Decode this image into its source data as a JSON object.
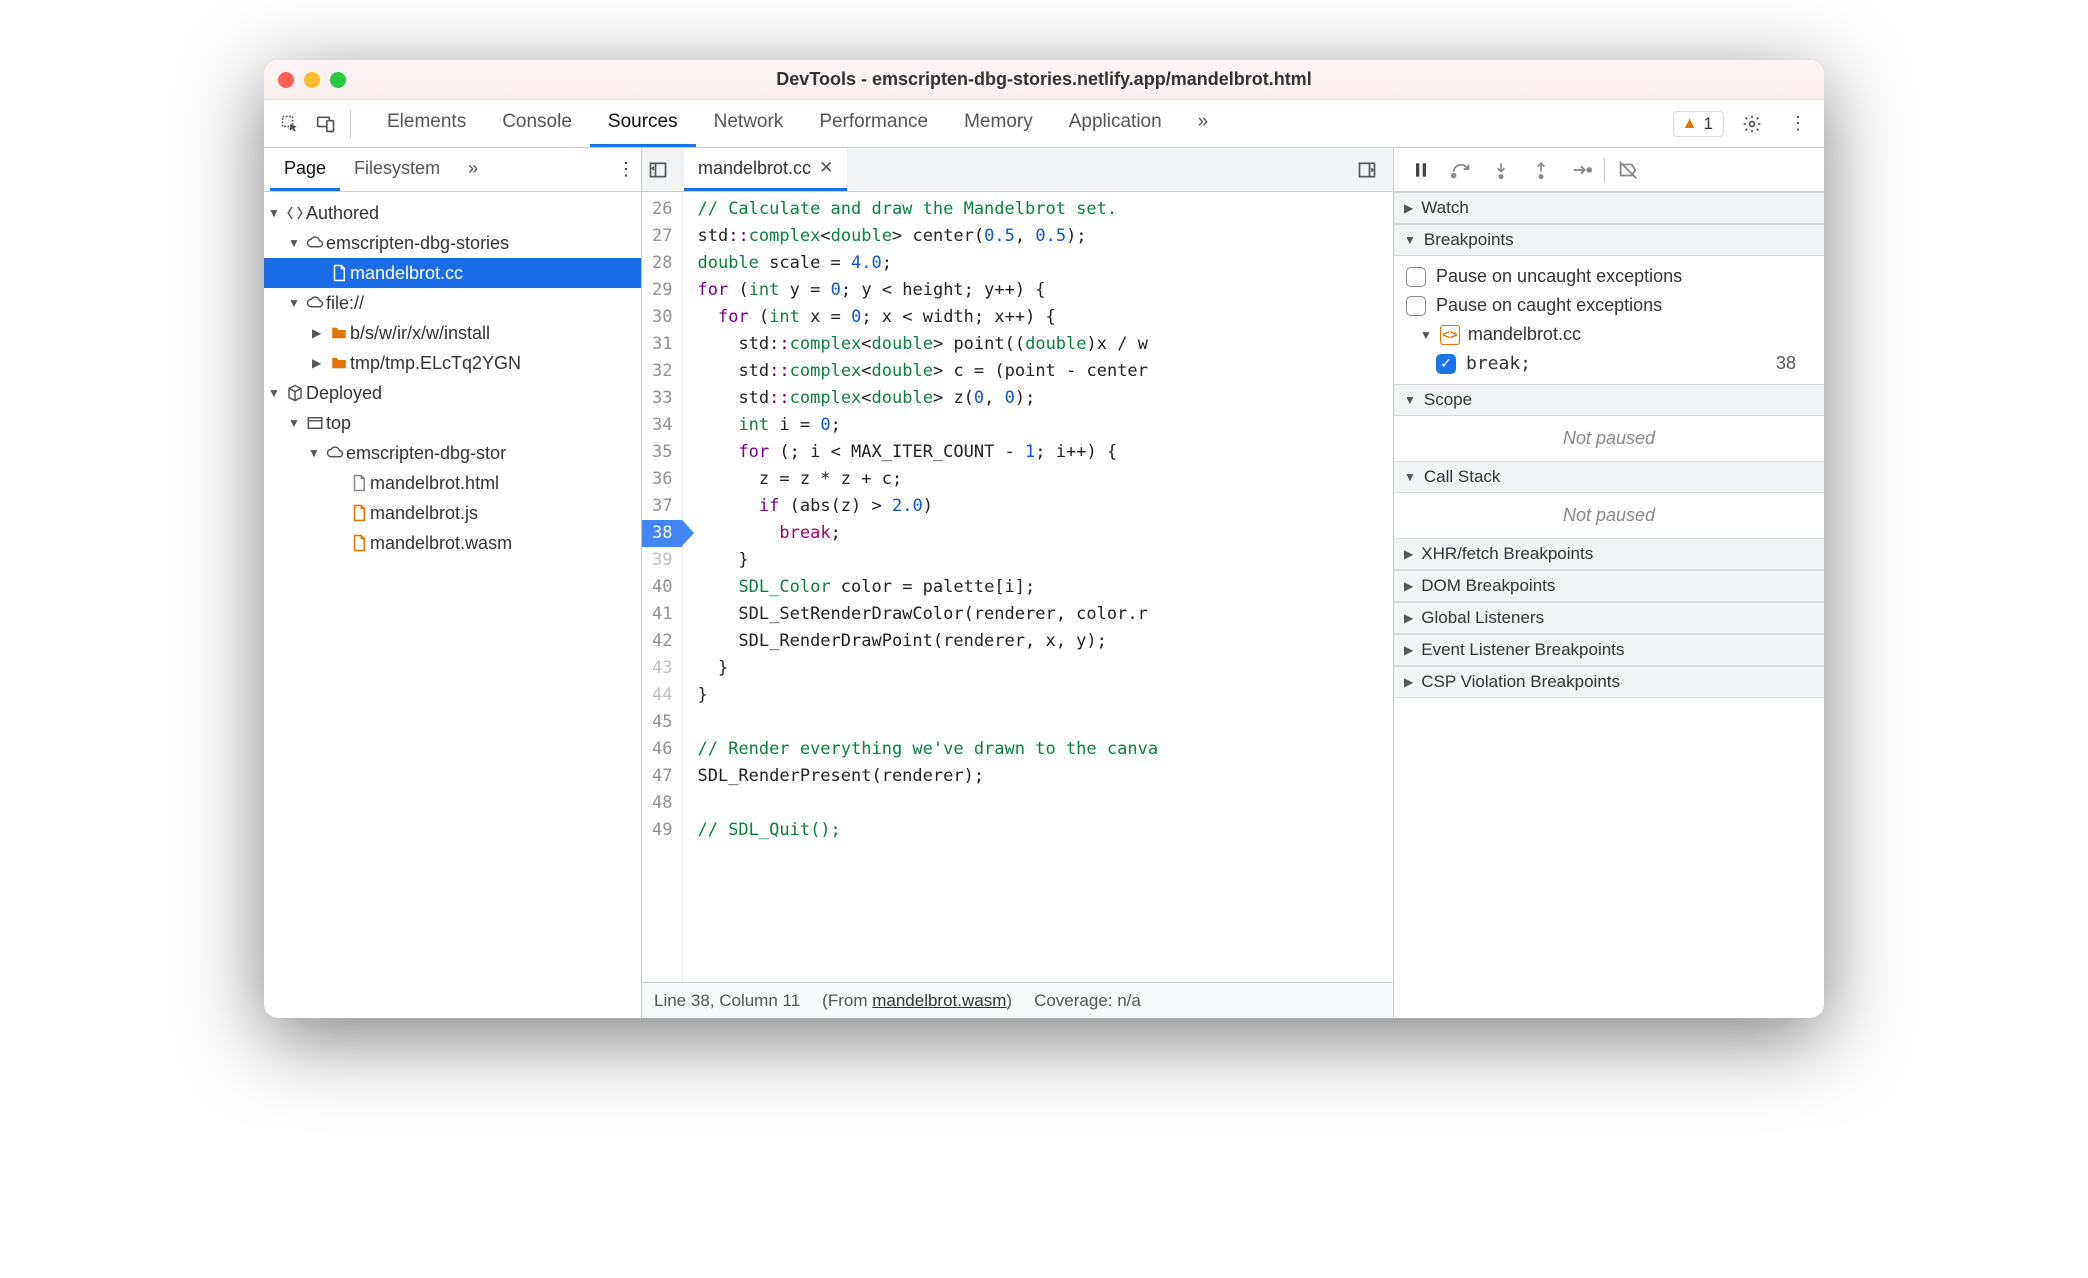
{
  "window": {
    "title": "DevTools - emscripten-dbg-stories.netlify.app/mandelbrot.html"
  },
  "toolbar": {
    "tabs": [
      "Elements",
      "Console",
      "Sources",
      "Network",
      "Performance",
      "Memory",
      "Application"
    ],
    "active": 2,
    "warning_count": "1"
  },
  "left": {
    "tabs": [
      "Page",
      "Filesystem"
    ],
    "active": 0,
    "tree": {
      "authored": "Authored",
      "emscripten": "emscripten-dbg-stories",
      "mandelbrot_cc": "mandelbrot.cc",
      "file_proto": "file://",
      "install": "b/s/w/ir/x/w/install",
      "tmp": "tmp/tmp.ELcTq2YGN",
      "deployed": "Deployed",
      "top": "top",
      "emscripten2": "emscripten-dbg-stor",
      "html": "mandelbrot.html",
      "js": "mandelbrot.js",
      "wasm": "mandelbrot.wasm"
    }
  },
  "center": {
    "file_tab": "mandelbrot.cc",
    "status": {
      "cursor": "Line 38, Column 11",
      "from_prefix": "(From ",
      "from_link": "mandelbrot.wasm",
      "from_suffix": ")",
      "coverage": "Coverage: n/a"
    },
    "lines": [
      {
        "n": 26,
        "html": "<span class='c-comment'>// Calculate and draw the Mandelbrot set.</span>"
      },
      {
        "n": 27,
        "html": "<span class='c-std'>std</span><span class='c-op'>::</span><span class='c-type'>complex</span>&lt;<span class='c-type'>double</span>&gt; center(<span class='c-num'>0.5</span>, <span class='c-num'>0.5</span>);"
      },
      {
        "n": 28,
        "html": "<span class='c-type'>double</span> scale = <span class='c-num'>4.0</span>;"
      },
      {
        "n": 29,
        "html": "<span class='c-kw'>for</span> (<span class='c-type'>int</span> y = <span class='c-num'>0</span>; y &lt; height; y++) {"
      },
      {
        "n": 30,
        "html": "  <span class='c-kw'>for</span> (<span class='c-type'>int</span> x = <span class='c-num'>0</span>; x &lt; width; x++) {"
      },
      {
        "n": 31,
        "html": "    <span class='c-std'>std</span><span class='c-op'>::</span><span class='c-type'>complex</span>&lt;<span class='c-type'>double</span>&gt; point((<span class='c-type'>double</span>)x / w"
      },
      {
        "n": 32,
        "html": "    <span class='c-std'>std</span><span class='c-op'>::</span><span class='c-type'>complex</span>&lt;<span class='c-type'>double</span>&gt; c = (point - center"
      },
      {
        "n": 33,
        "html": "    <span class='c-std'>std</span><span class='c-op'>::</span><span class='c-type'>complex</span>&lt;<span class='c-type'>double</span>&gt; z(<span class='c-num'>0</span>, <span class='c-num'>0</span>);"
      },
      {
        "n": 34,
        "html": "    <span class='c-type'>int</span> i = <span class='c-num'>0</span>;"
      },
      {
        "n": 35,
        "html": "    <span class='c-kw'>for</span> (; i &lt; MAX_ITER_COUNT - <span class='c-num'>1</span>; i++) {"
      },
      {
        "n": 36,
        "html": "      z = z * z + c;"
      },
      {
        "n": 37,
        "html": "      <span class='c-kw'>if</span> (abs(z) &gt; <span class='c-num'>2.0</span>)"
      },
      {
        "n": 38,
        "html": "        <span class='c-brk'>break</span>;",
        "bp": true
      },
      {
        "n": 39,
        "html": "    }",
        "off": true
      },
      {
        "n": 40,
        "html": "    <span class='c-func'>SDL_Color</span> color = palette[i];"
      },
      {
        "n": 41,
        "html": "    SDL_SetRenderDrawColor(renderer, color.r"
      },
      {
        "n": 42,
        "html": "    SDL_RenderDrawPoint(renderer, x, y);"
      },
      {
        "n": 43,
        "html": "  }",
        "off": true
      },
      {
        "n": 44,
        "html": "}",
        "off": true
      },
      {
        "n": 45,
        "html": ""
      },
      {
        "n": 46,
        "html": "<span class='c-comment'>// Render everything we've drawn to the canva</span>"
      },
      {
        "n": 47,
        "html": "SDL_RenderPresent(renderer);"
      },
      {
        "n": 48,
        "html": ""
      },
      {
        "n": 49,
        "html": "<span class='c-comment'>// SDL_Quit();</span>"
      }
    ]
  },
  "right": {
    "watch": "Watch",
    "breakpoints": "Breakpoints",
    "pause_uncaught": "Pause on uncaught exceptions",
    "pause_caught": "Pause on caught exceptions",
    "bp_file": "mandelbrot.cc",
    "bp_code": "break;",
    "bp_line": "38",
    "scope": "Scope",
    "not_paused": "Not paused",
    "callstack": "Call Stack",
    "xhr": "XHR/fetch Breakpoints",
    "dom": "DOM Breakpoints",
    "global": "Global Listeners",
    "event": "Event Listener Breakpoints",
    "csp": "CSP Violation Breakpoints"
  }
}
